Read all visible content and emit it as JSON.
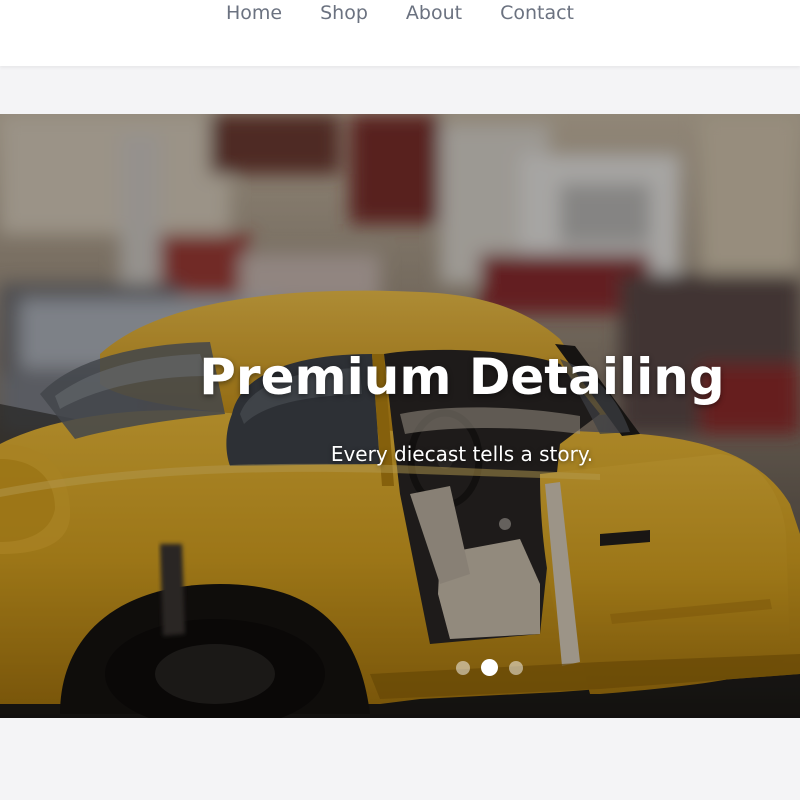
{
  "nav": {
    "items": [
      {
        "label": "Home"
      },
      {
        "label": "Shop"
      },
      {
        "label": "About"
      },
      {
        "label": "Contact"
      }
    ]
  },
  "hero": {
    "title": "Premium Detailing",
    "subtitle": "Every diecast tells a story.",
    "image_subject": "yellow diecast classic coupe with open door",
    "slides_total": 3,
    "active_slide": 2
  },
  "colors": {
    "nav_text": "#6b7280",
    "car_body": "#d9a421",
    "page_bg": "#f4f4f6"
  }
}
